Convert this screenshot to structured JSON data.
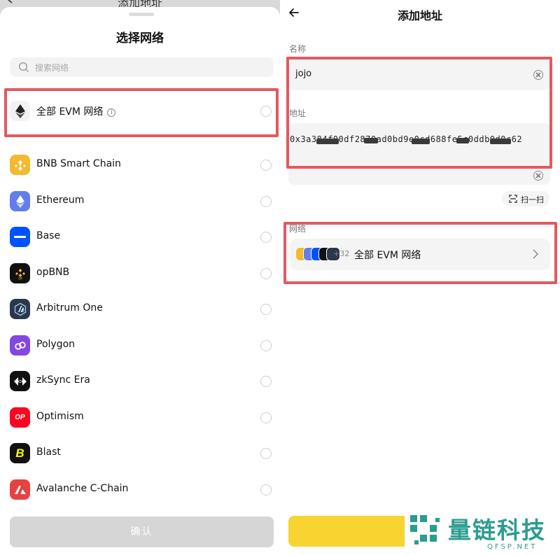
{
  "left_panel": {
    "behind_title": "添加地址",
    "sheet_title": "选择网络",
    "search_placeholder": "搜索网络",
    "networks": [
      {
        "label": "全部 EVM 网络",
        "icon": "ethereum-diamond-icon",
        "color": "#f2f2f2",
        "selected": false,
        "has_info": true
      },
      {
        "label": "BNB Smart Chain",
        "icon": "bnb-icon",
        "color": "#f3ba2f",
        "selected": false
      },
      {
        "label": "Ethereum",
        "icon": "ethereum-icon",
        "color": "#627eea",
        "selected": false
      },
      {
        "label": "Base",
        "icon": "base-icon",
        "color": "#0052ff",
        "selected": false
      },
      {
        "label": "opBNB",
        "icon": "opbnb-icon",
        "color": "#111111",
        "selected": false
      },
      {
        "label": "Arbitrum One",
        "icon": "arbitrum-icon",
        "color": "#2d374b",
        "selected": false
      },
      {
        "label": "Polygon",
        "icon": "polygon-icon",
        "color": "#8247e5",
        "selected": false
      },
      {
        "label": "zkSync Era",
        "icon": "zksync-icon",
        "color": "#111111",
        "selected": false
      },
      {
        "label": "Optimism",
        "icon": "optimism-icon",
        "color": "#ff0420",
        "selected": false
      },
      {
        "label": "Blast",
        "icon": "blast-icon",
        "color": "#111111",
        "selected": false
      },
      {
        "label": "Avalanche C-Chain",
        "icon": "avalanche-icon",
        "color": "#e84142",
        "selected": false
      }
    ],
    "confirm_label": "确认"
  },
  "right_panel": {
    "title": "添加地址",
    "name_label": "名称",
    "name_value": "jojo",
    "address_label": "地址",
    "address_value": "0x3a384f00df2870ad0bd9e0cd688fe5c0ddb0d0c62",
    "scan_label": "扫一扫",
    "network_label": "网络",
    "network_value": "全部 EVM 网络",
    "network_extra_count": "+32"
  },
  "watermark": {
    "name": "量链科技",
    "domain": "QFSP.NET"
  },
  "colors": {
    "highlight": "#e25a5f",
    "accent_yellow": "#f8d431",
    "watermark": "#2c9c8f"
  }
}
